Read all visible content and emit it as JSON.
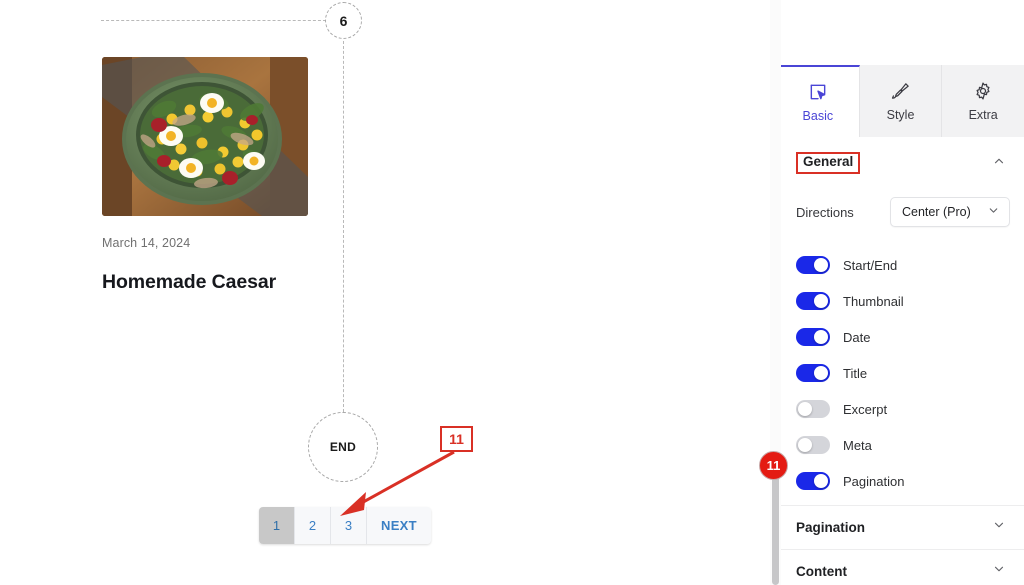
{
  "canvas": {
    "marker_top": "6",
    "marker_end": "END",
    "post": {
      "date": "March 14, 2024",
      "title": "Homemade Caesar",
      "thumbnail_icon": "salad-bowl-photo"
    },
    "pagination": {
      "items": [
        {
          "label": "1",
          "active": true
        },
        {
          "label": "2",
          "active": false
        },
        {
          "label": "3",
          "active": false
        },
        {
          "label": "NEXT",
          "active": false
        }
      ]
    },
    "annotation": {
      "step_number": "11",
      "color": "#d93025"
    }
  },
  "panel": {
    "tabs": [
      {
        "label": "Basic",
        "icon": "cursor-box-icon",
        "active": true
      },
      {
        "label": "Style",
        "icon": "paintbrush-icon",
        "active": false
      },
      {
        "label": "Extra",
        "icon": "gear-icon",
        "active": false
      }
    ],
    "general": {
      "title": "General",
      "chevron": "chevron-up-icon",
      "directions": {
        "label": "Directions",
        "value": "Center (Pro)",
        "chevron": "chevron-down-icon"
      },
      "toggles": [
        {
          "label": "Start/End",
          "on": true
        },
        {
          "label": "Thumbnail",
          "on": true
        },
        {
          "label": "Date",
          "on": true
        },
        {
          "label": "Title",
          "on": true
        },
        {
          "label": "Excerpt",
          "on": false
        },
        {
          "label": "Meta",
          "on": false
        },
        {
          "label": "Pagination",
          "on": true
        }
      ]
    },
    "sections": [
      {
        "title": "Pagination",
        "chevron": "chevron-down-icon"
      },
      {
        "title": "Content",
        "chevron": "chevron-down-icon"
      }
    ],
    "badge": {
      "number": "11"
    },
    "accent_color": "#4a45d6",
    "toggle_on_color": "#1a28e8"
  }
}
